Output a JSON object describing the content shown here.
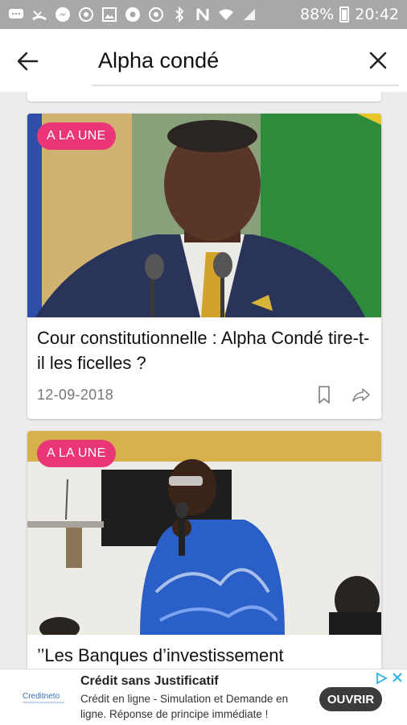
{
  "status_bar": {
    "battery_text": "88%",
    "time": "20:42",
    "icons": [
      "messages-icon",
      "missed-call-icon",
      "messenger-icon",
      "vpn-icon",
      "gallery-icon",
      "chrome-icon",
      "vpn-icon",
      "bluetooth-icon",
      "nfc-icon",
      "wifi-icon",
      "signal-icon",
      "battery-icon"
    ]
  },
  "search": {
    "query": "Alpha condé",
    "back_icon": "arrow-left-icon",
    "close_icon": "close-icon"
  },
  "articles": [
    {
      "badge": "A LA UNE",
      "title": "Cour constitutionnelle : Alpha Condé tire-t-il les ficelles ?",
      "date": "12-09-2018",
      "image": "photo-man-suit-microphones",
      "actions": [
        "bookmark-icon",
        "share-icon"
      ]
    },
    {
      "badge": "A LA UNE",
      "title": "’’Les Banques d’investissement",
      "image": "photo-speaker-blue-shirt"
    }
  ],
  "ad": {
    "title": "Crédit sans Justificatif",
    "text": "Crédit en ligne - Simulation et Demande en ligne. Réponse de principe immédiate !",
    "cta": "OUVRIR",
    "logo": "creditneto-logo",
    "colors": {
      "cta_bg": "#3c3c3c",
      "badge": "#ea3576"
    }
  }
}
